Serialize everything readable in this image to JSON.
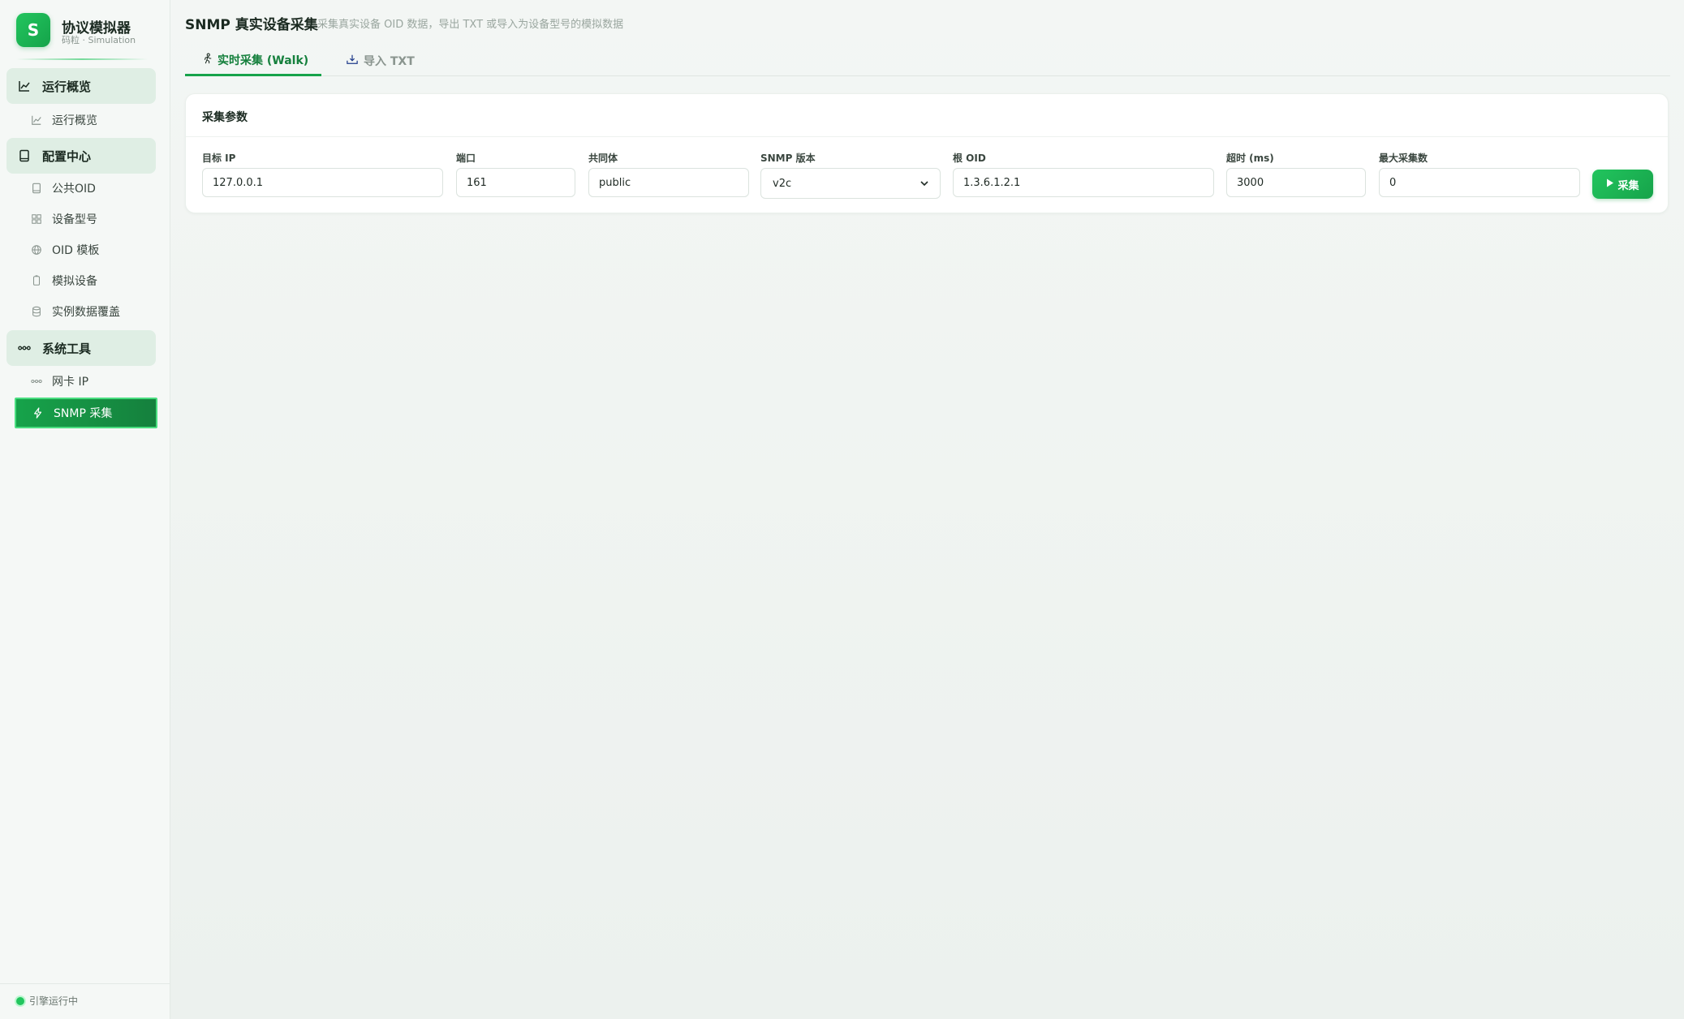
{
  "brand": {
    "logo_letter": "S",
    "title": "协议模拟器",
    "subtitle": "码粒 · Simulation"
  },
  "sidebar": {
    "groups": [
      {
        "label": "运行概览",
        "icon": "chart-line-icon",
        "items": [
          {
            "label": "运行概览",
            "icon": "chart-line-icon"
          }
        ]
      },
      {
        "label": "配置中心",
        "icon": "book-icon",
        "items": [
          {
            "label": "公共OID",
            "icon": "book-icon"
          },
          {
            "label": "设备型号",
            "icon": "grid-icon"
          },
          {
            "label": "OID 模板",
            "icon": "globe-icon"
          },
          {
            "label": "模拟设备",
            "icon": "device-icon"
          },
          {
            "label": "实例数据覆盖",
            "icon": "database-icon"
          }
        ]
      },
      {
        "label": "系统工具",
        "icon": "network-icon",
        "items": [
          {
            "label": "网卡 IP",
            "icon": "network-icon"
          },
          {
            "label": "SNMP 采集",
            "icon": "bolt-icon",
            "active": true
          }
        ]
      }
    ],
    "engine_status": "引擎运行中"
  },
  "page": {
    "title": "SNMP 真实设备采集",
    "subtitle": "采集真实设备 OID 数据，导出 TXT 或导入为设备型号的模拟数据"
  },
  "tabs": [
    {
      "label": "实时采集 (Walk)",
      "icon": "walk-icon",
      "active": true
    },
    {
      "label": "导入 TXT",
      "icon": "import-icon",
      "active": false
    }
  ],
  "form": {
    "card_title": "采集参数",
    "target_ip": {
      "label": "目标 IP",
      "value": "127.0.0.1"
    },
    "port": {
      "label": "端口",
      "value": "161"
    },
    "community": {
      "label": "共同体",
      "value": "public"
    },
    "snmp_version": {
      "label": "SNMP 版本",
      "value": "v2c"
    },
    "root_oid": {
      "label": "根 OID",
      "value": "1.3.6.1.2.1"
    },
    "timeout": {
      "label": "超时 (ms)",
      "value": "3000"
    },
    "max_count": {
      "label": "最大采集数",
      "value": "0"
    },
    "submit_label": "采集"
  },
  "colors": {
    "accent": "#16a34a",
    "accent_light": "#22c55e",
    "group_bg": "#dfeee4"
  }
}
